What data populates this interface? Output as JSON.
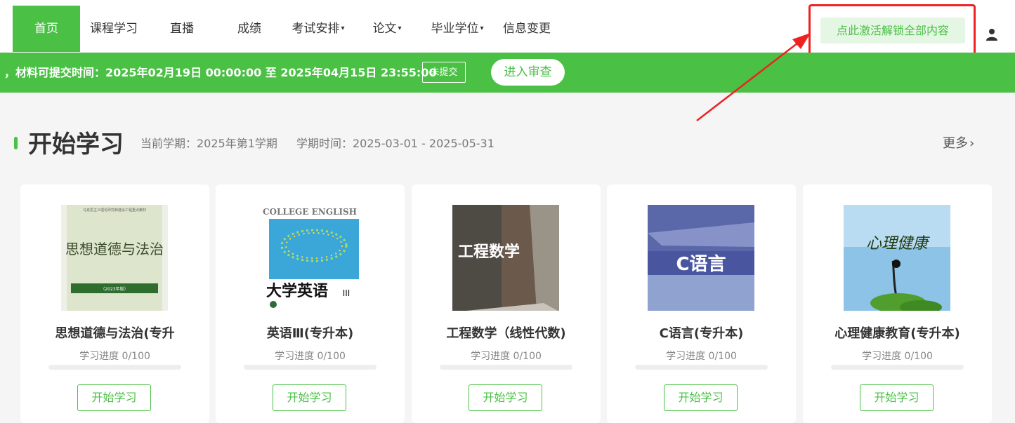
{
  "nav": {
    "items": [
      {
        "label": "首页",
        "active": true,
        "caret": false
      },
      {
        "label": "课程学习",
        "active": false,
        "caret": false
      },
      {
        "label": "直播",
        "active": false,
        "caret": false
      },
      {
        "label": "成绩",
        "active": false,
        "caret": false
      },
      {
        "label": "考试安排",
        "active": false,
        "caret": true
      },
      {
        "label": "论文",
        "active": false,
        "caret": true
      },
      {
        "label": "毕业学位",
        "active": false,
        "caret": true
      },
      {
        "label": "信息变更",
        "active": false,
        "caret": false
      }
    ],
    "activate_label": "点此激活解锁全部内容",
    "user_icon": "user-icon"
  },
  "banner": {
    "text": "，材料可提交时间：2025年02月19日 00:00:00 至 2025年04月15日 23:55:00",
    "status_badge": "未提交",
    "review_button": "进入审查"
  },
  "section": {
    "title": "开始学习",
    "semester": "当前学期：2025年第1学期",
    "period": "学期时间：2025-03-01 - 2025-05-31",
    "more": "更多"
  },
  "courses": [
    {
      "name": "思想道德与法治(专升",
      "progress_text": "学习进度 0/100",
      "progress": 0,
      "start_label": "开始学习",
      "cover_title": "思想道德与法治",
      "cover_top": "马克思主义理论研究和建设工程重点教材",
      "cover_edition": "（2023年版）"
    },
    {
      "name": "英语Ⅲ(专升本)",
      "progress_text": "学习进度 0/100",
      "progress": 0,
      "start_label": "开始学习",
      "cover_title": "COLLEGE ENGLISH",
      "cover_bottom": "大学英语",
      "cover_suffix": "III"
    },
    {
      "name": "工程数学（线性代数)",
      "progress_text": "学习进度 0/100",
      "progress": 0,
      "start_label": "开始学习",
      "cover_title": "工程数学"
    },
    {
      "name": "C语言(专升本)",
      "progress_text": "学习进度 0/100",
      "progress": 0,
      "start_label": "开始学习",
      "cover_title": "C语言"
    },
    {
      "name": "心理健康教育(专升本)",
      "progress_text": "学习进度 0/100",
      "progress": 0,
      "start_label": "开始学习",
      "cover_title": "心理健康"
    }
  ],
  "colors": {
    "accent": "#4ac045",
    "annotation": "#ee2222"
  }
}
